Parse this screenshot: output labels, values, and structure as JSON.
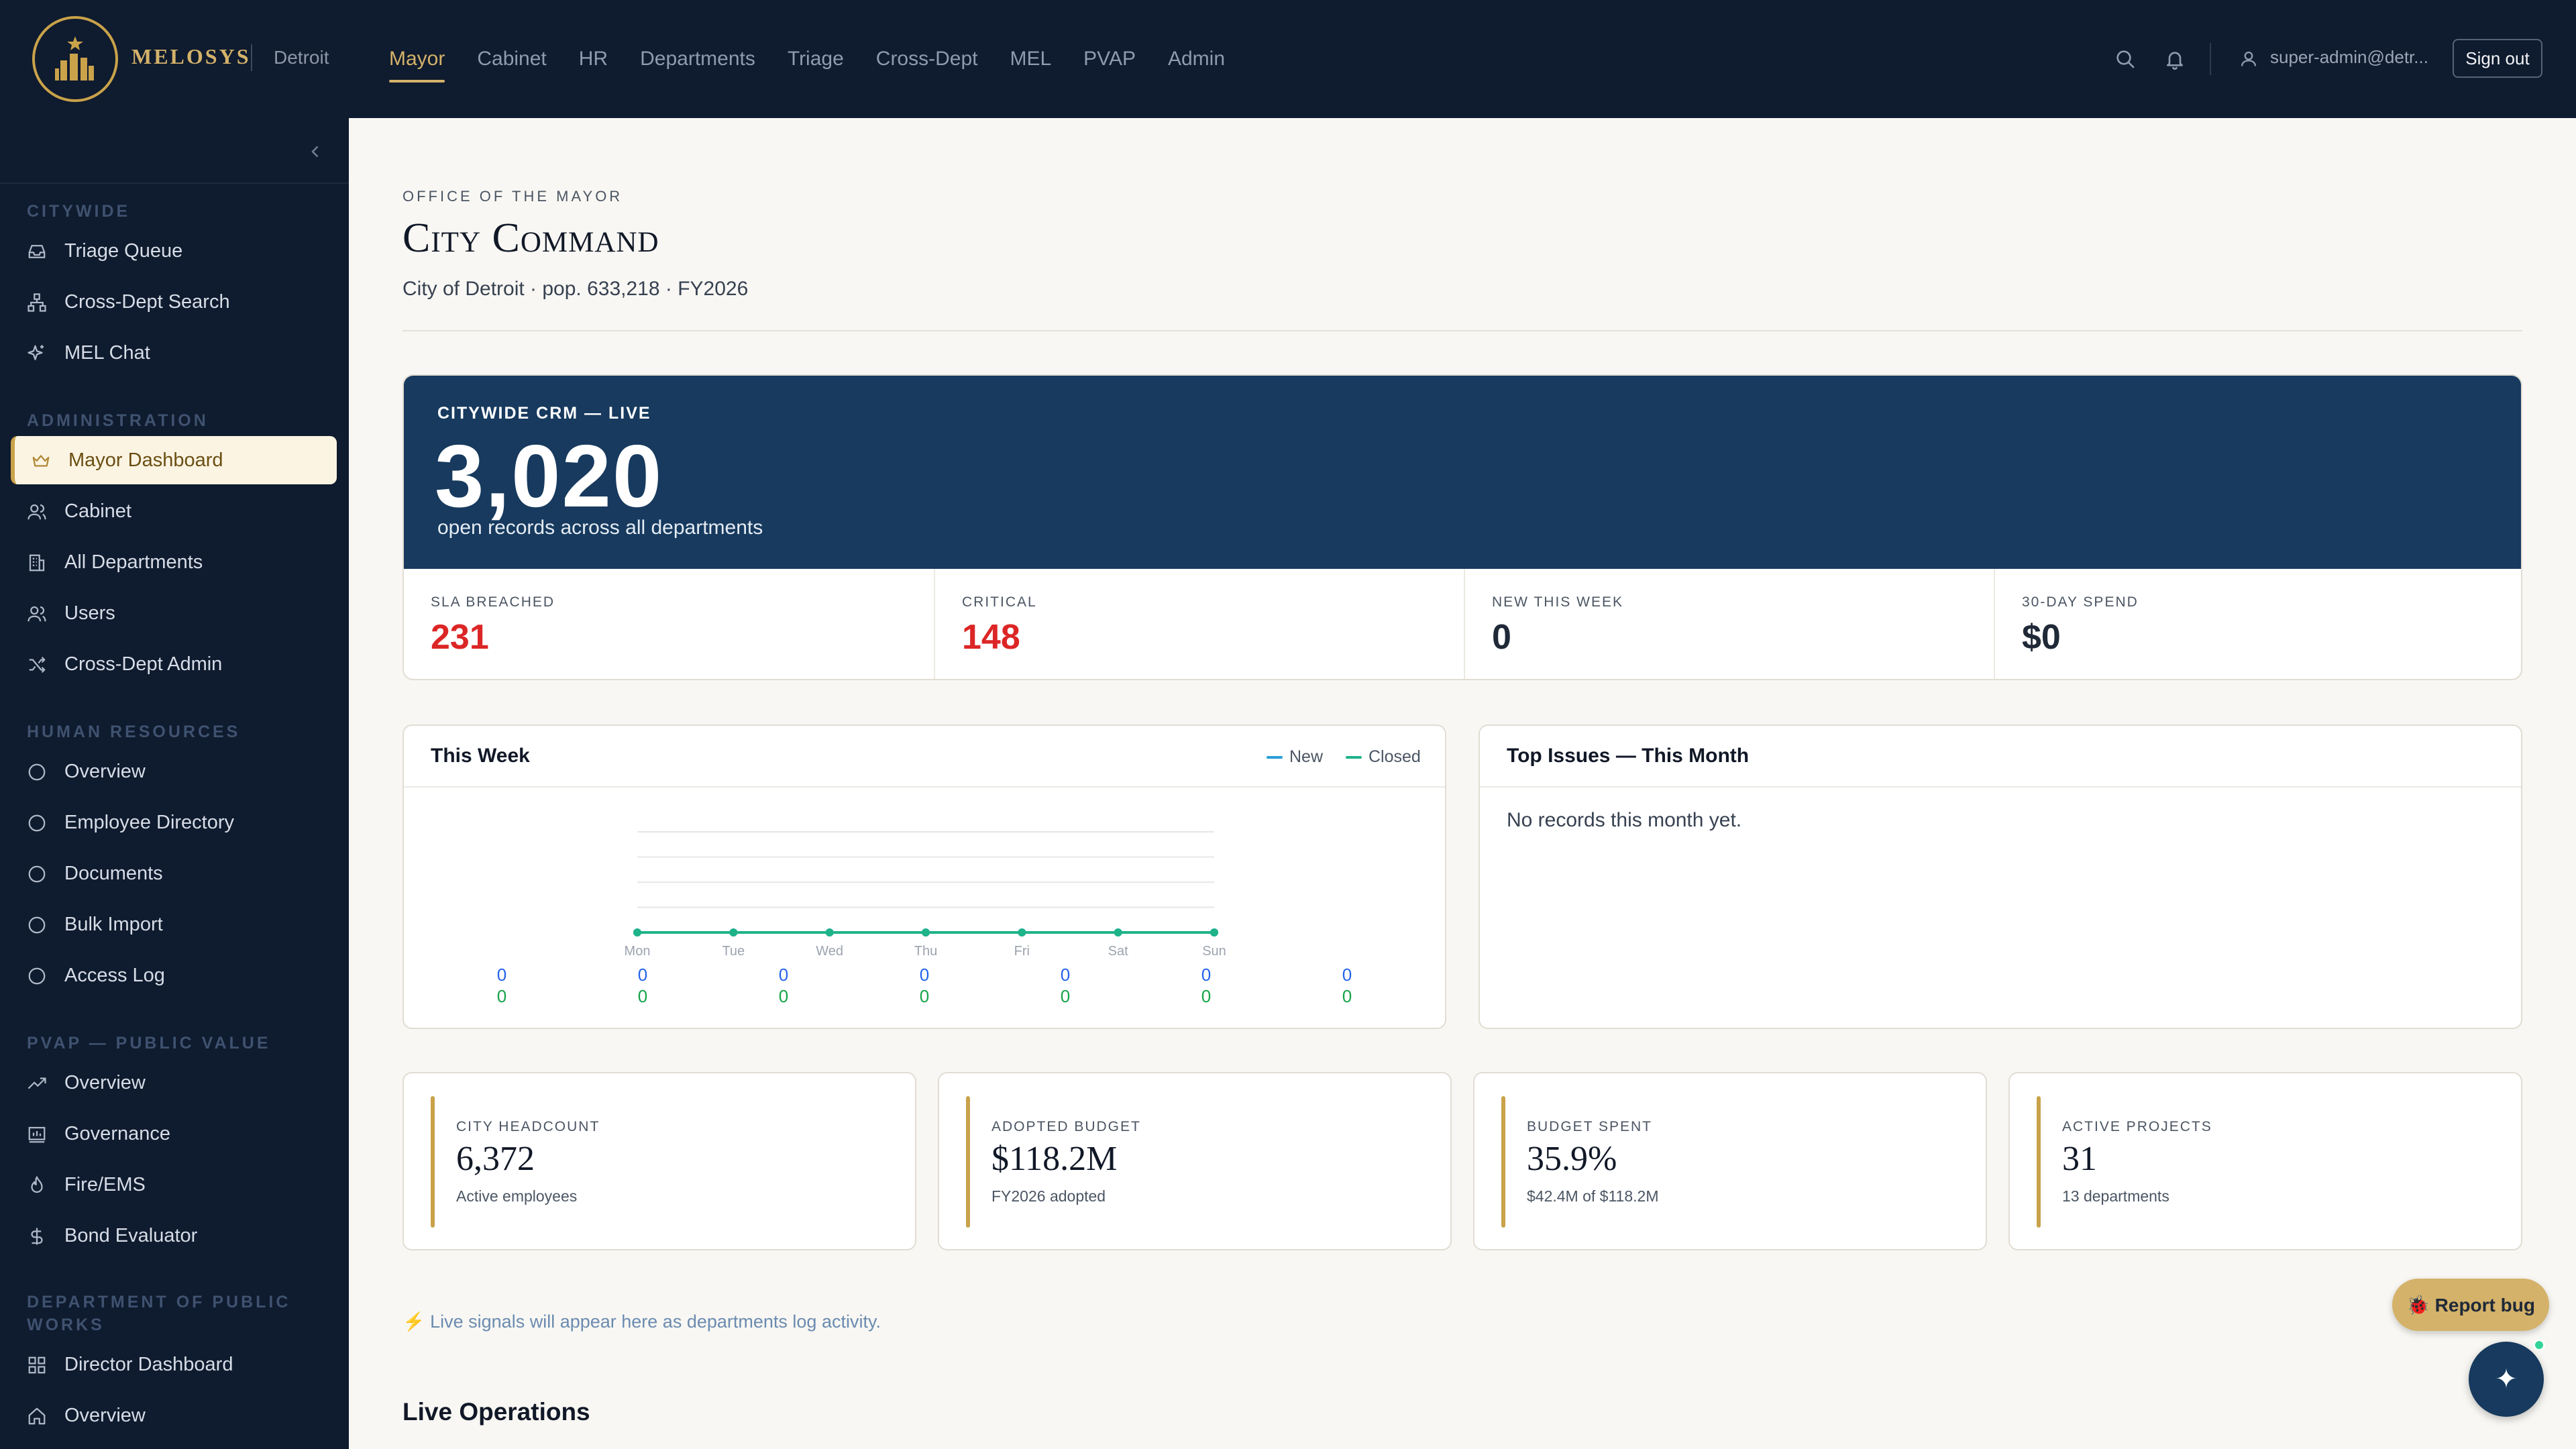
{
  "header": {
    "brand": "MELOSYS",
    "city": "Detroit",
    "nav": [
      "Mayor",
      "Cabinet",
      "HR",
      "Departments",
      "Triage",
      "Cross-Dept",
      "MEL",
      "PVAP",
      "Admin"
    ],
    "active_nav": "Mayor",
    "user_email": "super-admin@detr...",
    "signout_label": "Sign out"
  },
  "sidebar": {
    "sections": [
      {
        "title": "CITYWIDE",
        "items": [
          {
            "label": "Triage Queue",
            "icon": "inbox-icon"
          },
          {
            "label": "Cross-Dept Search",
            "icon": "network-icon"
          },
          {
            "label": "MEL Chat",
            "icon": "sparkle-icon"
          }
        ]
      },
      {
        "title": "ADMINISTRATION",
        "items": [
          {
            "label": "Mayor Dashboard",
            "icon": "crown-icon",
            "active": true
          },
          {
            "label": "Cabinet",
            "icon": "users-icon"
          },
          {
            "label": "All Departments",
            "icon": "building-icon"
          },
          {
            "label": "Users",
            "icon": "users-icon"
          },
          {
            "label": "Cross-Dept Admin",
            "icon": "shuffle-icon"
          }
        ]
      },
      {
        "title": "HUMAN RESOURCES",
        "items": [
          {
            "label": "Overview",
            "icon": "circle-icon"
          },
          {
            "label": "Employee Directory",
            "icon": "circle-icon"
          },
          {
            "label": "Documents",
            "icon": "circle-icon"
          },
          {
            "label": "Bulk Import",
            "icon": "circle-icon"
          },
          {
            "label": "Access Log",
            "icon": "circle-icon"
          }
        ]
      },
      {
        "title": "PVAP — PUBLIC VALUE",
        "items": [
          {
            "label": "Overview",
            "icon": "trend-icon"
          },
          {
            "label": "Governance",
            "icon": "governance-icon"
          },
          {
            "label": "Fire/EMS",
            "icon": "flame-icon"
          },
          {
            "label": "Bond Evaluator",
            "icon": "dollar-icon"
          }
        ]
      },
      {
        "title": "DEPARTMENT OF PUBLIC WORKS",
        "items": [
          {
            "label": "Director Dashboard",
            "icon": "grid-icon"
          },
          {
            "label": "Overview",
            "icon": "home-icon"
          }
        ]
      }
    ]
  },
  "page": {
    "eyebrow": "OFFICE OF THE MAYOR",
    "title": "City Command",
    "subtitle": "City of Detroit · pop. 633,218 · FY2026"
  },
  "crm": {
    "label": "CITYWIDE CRM — LIVE",
    "value": "3,020",
    "caption": "open records across all departments",
    "stats": [
      {
        "label": "SLA BREACHED",
        "value": "231",
        "color": "#dc2626"
      },
      {
        "label": "CRITICAL",
        "value": "148",
        "color": "#dc2626"
      },
      {
        "label": "NEW THIS WEEK",
        "value": "0",
        "color": "#1f2937"
      },
      {
        "label": "30-DAY SPEND",
        "value": "$0",
        "color": "#1f2937"
      }
    ]
  },
  "week_panel": {
    "title": "This Week",
    "legend": [
      "New",
      "Closed"
    ],
    "colors": {
      "new": "#2a9fd6",
      "closed": "#1fb38a",
      "new_value": "#2563eb",
      "closed_value": "#16a34a"
    },
    "new_values_row": [
      "0",
      "0",
      "0",
      "0",
      "0",
      "0",
      "0"
    ],
    "closed_values_row": [
      "0",
      "0",
      "0",
      "0",
      "0",
      "0",
      "0"
    ]
  },
  "chart_data": {
    "type": "line",
    "categories": [
      "Mon",
      "Tue",
      "Wed",
      "Thu",
      "Fri",
      "Sat",
      "Sun"
    ],
    "series": [
      {
        "name": "New",
        "values": [
          0,
          0,
          0,
          0,
          0,
          0,
          0
        ]
      },
      {
        "name": "Closed",
        "values": [
          0,
          0,
          0,
          0,
          0,
          0,
          0
        ]
      }
    ],
    "title": "This Week",
    "legend": "top-right",
    "grid": true
  },
  "issues_panel": {
    "title": "Top Issues — This Month",
    "empty": "No records this month yet."
  },
  "metrics": [
    {
      "label": "CITY HEADCOUNT",
      "value": "6,372",
      "sub": "Active employees"
    },
    {
      "label": "ADOPTED BUDGET",
      "value": "$118.2M",
      "sub": "FY2026 adopted"
    },
    {
      "label": "BUDGET SPENT",
      "value": "35.9%",
      "sub": "$42.4M of $118.2M"
    },
    {
      "label": "ACTIVE PROJECTS",
      "value": "31",
      "sub": "13 departments"
    }
  ],
  "signal": "⚡ Live signals will appear here as departments log activity.",
  "live_ops_title": "Live Operations",
  "report_bug_label": "🐞 Report bug",
  "fab_glyph": "✦"
}
